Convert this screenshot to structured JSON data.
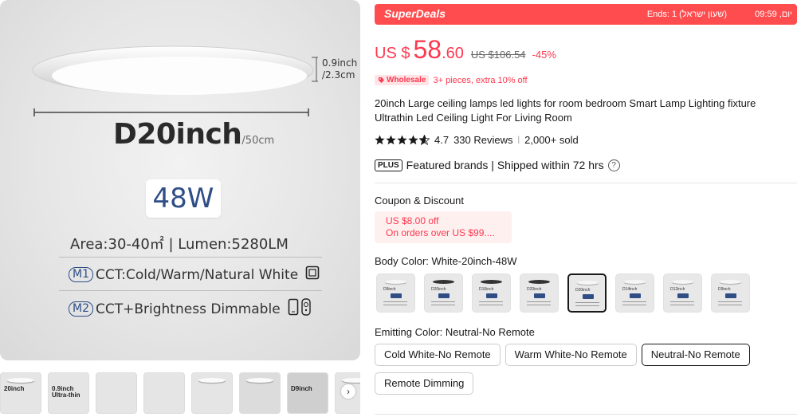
{
  "gallery": {
    "main": {
      "thickness": "0.9inch",
      "thickness_cm": "/2.3cm",
      "diameter": "D20inch",
      "diameter_cm": "/50cm",
      "wattage": "48W",
      "area_lumen": "Area:30-40㎡  |  Lumen:5280LM",
      "mode1_tag": "M1",
      "mode1_text": "CCT:Cold/Warm/Natural White",
      "mode2_tag": "M2",
      "mode2_text": "CCT+Brightness Dimmable"
    },
    "thumbnails": [
      {
        "text": "20inch"
      },
      {
        "text": "0.9inch Ultra-thin"
      },
      {
        "text": ""
      },
      {
        "text": ""
      },
      {
        "text": ""
      },
      {
        "text": ""
      },
      {
        "text": "D9inch"
      },
      {
        "text": ""
      }
    ],
    "next_arrow": "›"
  },
  "superdeals": {
    "title": "SuperDeals",
    "ends": "Ends: 1 (שעון ישראל)",
    "time": "יום, 09:59"
  },
  "price": {
    "currency": "US $",
    "integer": "58",
    "decimal": ".60",
    "original": "US $106.54",
    "discount": "-45%"
  },
  "wholesale": {
    "badge": "Wholesale",
    "text": "3+ pieces, extra 10% off"
  },
  "product_title": "20inch Large ceiling lamps led lights for room bedroom Smart Lamp Lighting fixture Ultrathin Led Ceiling Light For Living Room",
  "rating": {
    "score": "4.7",
    "reviews": "330 Reviews",
    "separator": "|",
    "sold": "2,000+ sold"
  },
  "plus": {
    "badge": "PLUS",
    "text": "Featured brands | Shipped within 72 hrs",
    "info_icon": "?"
  },
  "coupon": {
    "label": "Coupon & Discount",
    "line1": "US $8.00 off",
    "line2": "On orders over US $99...."
  },
  "body_color": {
    "label": "Body Color: White-20inch-48W",
    "swatches": [
      {
        "name": "D9inch",
        "style": "light"
      },
      {
        "name": "D20inch",
        "style": "dark"
      },
      {
        "name": "D16inch",
        "style": "dark"
      },
      {
        "name": "D20inch",
        "style": "dark"
      },
      {
        "name": "D20inch",
        "style": "light",
        "selected": true
      },
      {
        "name": "D14inch",
        "style": "light"
      },
      {
        "name": "D12inch",
        "style": "light"
      },
      {
        "name": "D9inch",
        "style": "light"
      }
    ]
  },
  "emitting_color": {
    "label": "Emitting Color: Neutral-No Remote",
    "options": [
      {
        "label": "Cold White-No Remote"
      },
      {
        "label": "Warm White-No Remote"
      },
      {
        "label": "Neutral-No Remote",
        "selected": true
      },
      {
        "label": "Remote Dimming"
      }
    ]
  },
  "colors": {
    "accent": "#fd384f",
    "superdeals_bg": "#ff4d4f",
    "spec_blue": "#2f4e86"
  }
}
